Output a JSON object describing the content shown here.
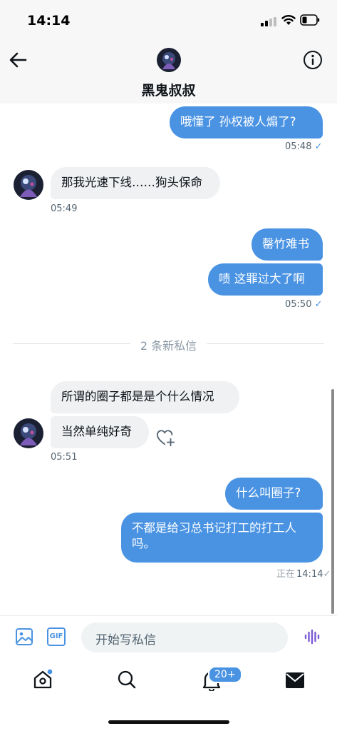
{
  "status_bar": {
    "time": "14:14"
  },
  "header": {
    "title": "黑鬼叔叔"
  },
  "messages": [
    {
      "text": "哦懂了 孙权被人煽了?",
      "time": "05:48",
      "check": "✓"
    },
    {
      "text": "那我光速下线……狗头保命",
      "time": "05:49"
    },
    {
      "text": "罄竹难书"
    },
    {
      "text": "啧 这罪过大了啊",
      "time": "05:50",
      "check": "✓"
    },
    {
      "text": "所谓的圈子都是是个什么情况"
    },
    {
      "text": "当然单纯好奇",
      "time": "05:51"
    },
    {
      "text": "什么叫圈子?"
    },
    {
      "text_line1": "不都是给习总书记打工的打工人",
      "text_line2": "吗。",
      "time": "14:14",
      "status_prefix": "正在",
      "check": "✓"
    }
  ],
  "divider": {
    "text": "2 条新私信"
  },
  "composer": {
    "placeholder": "开始写私信",
    "gif_label": "GIF"
  },
  "tabbar": {
    "notifications_badge": "20+"
  },
  "colors": {
    "accent": "#4a93e3",
    "incoming_bubble": "#eff1f3"
  }
}
